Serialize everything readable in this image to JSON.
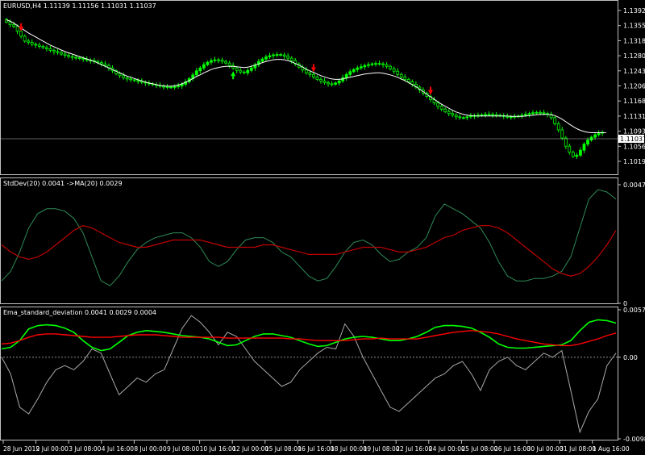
{
  "colors": {
    "background": "#000000",
    "frame": "#c0c0c0",
    "bull": "#00ff00",
    "bear": "#000000",
    "wick": "#00ff00",
    "ma": "#ffffff",
    "stddev": "#2e8b57",
    "stddev_ma": "#c00000",
    "ema_green": "#00ff00",
    "ema_red": "#ff0000",
    "ema_gray": "#a9a9a9",
    "arrow_sell": "#ff0000",
    "arrow_buy": "#00ff00"
  },
  "panels": {
    "main": {
      "title": "EURUSD,H4  1.11139 1.11156 1.11031 1.11037",
      "price_ticks": [
        "1.13920",
        "1.13550",
        "1.13180",
        "1.12800",
        "1.12430",
        "1.12060",
        "1.11680",
        "1.11310",
        "1.10930",
        "1.10560",
        "1.10190"
      ],
      "current_price": "1.11037"
    },
    "stddev": {
      "title": "StdDev(20) 0.0041  ->MA(20) 0.0029",
      "ticks": [
        "0.0047",
        "0"
      ]
    },
    "ema": {
      "title": "Ema_standard_deviation 0.0041 0.0029 0.0004",
      "ticks": [
        "0.0057",
        "0.00",
        "-0.0098"
      ]
    }
  },
  "time_labels": [
    "28 Jun 2019",
    "2 Jul 00:00",
    "3 Jul 08:00",
    "4 Jul 16:00",
    "8 Jul 00:00",
    "9 Jul 08:00",
    "10 Jul 16:00",
    "12 Jul 00:00",
    "15 Jul 08:00",
    "16 Jul 16:00",
    "18 Jul 00:00",
    "19 Jul 08:00",
    "22 Jul 16:00",
    "24 Jul 00:00",
    "25 Jul 08:00",
    "26 Jul 16:00",
    "30 Jul 00:00",
    "31 Jul 08:00",
    "1 Aug 16:00"
  ],
  "chart_data": [
    {
      "type": "candlestick",
      "title": "EURUSD,H4  1.11139 1.11156 1.11031 1.11037",
      "ylim": [
        1.1005,
        1.1405
      ],
      "close": [
        1.1375,
        1.1368,
        1.1364,
        1.1352,
        1.134,
        1.1328,
        1.1325,
        1.132,
        1.1318,
        1.1315,
        1.1312,
        1.1309,
        1.1305,
        1.1302,
        1.13,
        1.1296,
        1.1293,
        1.129,
        1.1288,
        1.1287,
        1.1285,
        1.1283,
        1.1281,
        1.128,
        1.1278,
        1.1275,
        1.1272,
        1.1268,
        1.1262,
        1.1255,
        1.1248,
        1.1243,
        1.1238,
        1.1235,
        1.1233,
        1.1231,
        1.1229,
        1.1227,
        1.1225,
        1.1223,
        1.1221,
        1.1219,
        1.1217,
        1.1216,
        1.1215,
        1.1215,
        1.1216,
        1.1218,
        1.1222,
        1.1228,
        1.1236,
        1.1245,
        1.1255,
        1.1262,
        1.127,
        1.1276,
        1.128,
        1.1282,
        1.1281,
        1.1278,
        1.1274,
        1.1268,
        1.1262,
        1.1256,
        1.1252,
        1.125,
        1.1256,
        1.1262,
        1.127,
        1.1278,
        1.1284,
        1.1289,
        1.1292,
        1.1294,
        1.1295,
        1.1294,
        1.1291,
        1.1286,
        1.128,
        1.1272,
        1.1264,
        1.1257,
        1.125,
        1.1246,
        1.124,
        1.1234,
        1.123,
        1.1226,
        1.1223,
        1.1222,
        1.1225,
        1.123,
        1.1238,
        1.1246,
        1.1253,
        1.1258,
        1.1262,
        1.1265,
        1.1268,
        1.127,
        1.1272,
        1.1273,
        1.1272,
        1.127,
        1.1266,
        1.126,
        1.1254,
        1.1246,
        1.124,
        1.1234,
        1.1228,
        1.1222,
        1.1215,
        1.1208,
        1.12,
        1.1192,
        1.1184,
        1.1176,
        1.1168,
        1.1161,
        1.1155,
        1.115,
        1.1146,
        1.1142,
        1.114,
        1.114,
        1.1142,
        1.1144,
        1.1145,
        1.1146,
        1.1147,
        1.1148,
        1.1148,
        1.1147,
        1.1146,
        1.1145,
        1.1143,
        1.1142,
        1.1142,
        1.1143,
        1.1144,
        1.1146,
        1.1148,
        1.115,
        1.1152,
        1.1153,
        1.1152,
        1.115,
        1.1148,
        1.114,
        1.1125,
        1.111,
        1.109,
        1.107,
        1.1055,
        1.1045,
        1.1048,
        1.106,
        1.1075,
        1.1085,
        1.1092,
        1.1098,
        1.1102,
        1.1104
      ],
      "moving_average": [
        1.138,
        1.1377,
        1.1372,
        1.1366,
        1.136,
        1.1354,
        1.1348,
        1.1343,
        1.1338,
        1.1333,
        1.1328,
        1.1323,
        1.1318,
        1.1314,
        1.131,
        1.1306,
        1.1302,
        1.1299,
        1.1296,
        1.1293,
        1.129,
        1.1287,
        1.1284,
        1.1281,
        1.1278,
        1.1274,
        1.127,
        1.1266,
        1.1262,
        1.1258,
        1.1254,
        1.125,
        1.1246,
        1.1242,
        1.1239,
        1.1236,
        1.1233,
        1.123,
        1.1227,
        1.1225,
        1.1223,
        1.1221,
        1.1219,
        1.1218,
        1.1217,
        1.1217,
        1.1218,
        1.122,
        1.1223,
        1.1227,
        1.1231,
        1.1236,
        1.1241,
        1.1245,
        1.125,
        1.1254,
        1.1258,
        1.1261,
        1.1263,
        1.1265,
        1.1266,
        1.1266,
        1.1266,
        1.1265,
        1.1264,
        1.1263,
        1.1264,
        1.1266,
        1.1269,
        1.1272,
        1.1275,
        1.1278,
        1.128,
        1.1282,
        1.1283,
        1.1283,
        1.1282,
        1.128,
        1.1277,
        1.1273,
        1.1269,
        1.1264,
        1.1259,
        1.1255,
        1.1251,
        1.1247,
        1.1243,
        1.124,
        1.1237,
        1.1235,
        1.1234,
        1.1234,
        1.1235,
        1.1237,
        1.1239,
        1.1241,
        1.1243,
        1.1245,
        1.1247,
        1.1248,
        1.1249,
        1.125,
        1.125,
        1.1249,
        1.1247,
        1.1245,
        1.1242,
        1.1239,
        1.1235,
        1.1231,
        1.1226,
        1.1221,
        1.1216,
        1.121,
        1.1204,
        1.1197,
        1.1191,
        1.1185,
        1.1179,
        1.1173,
        1.1168,
        1.1163,
        1.1158,
        1.1154,
        1.1151,
        1.1148,
        1.1146,
        1.1145,
        1.1144,
        1.1144,
        1.1144,
        1.1144,
        1.1144,
        1.1144,
        1.1144,
        1.1144,
        1.1144,
        1.1144,
        1.1143,
        1.1143,
        1.1143,
        1.1143,
        1.1144,
        1.1145,
        1.1146,
        1.1147,
        1.1148,
        1.1148,
        1.1148,
        1.1147,
        1.1145,
        1.1141,
        1.1136,
        1.113,
        1.1124,
        1.1118,
        1.1113,
        1.1109,
        1.1106,
        1.1104,
        1.1103,
        1.1103,
        1.1103,
        1.1103,
        1.1103
      ]
    },
    {
      "type": "line",
      "title": "StdDev(20) 0.0041  ->MA(20) 0.0029",
      "ylim": [
        0,
        0.0047
      ],
      "series": [
        {
          "values": [
            0.0008,
            0.0012,
            0.002,
            0.003,
            0.0036,
            0.0038,
            0.0038,
            0.0037,
            0.0034,
            0.0028,
            0.0018,
            0.0008,
            0.0006,
            0.001,
            0.0016,
            0.0021,
            0.0024,
            0.0026,
            0.0027,
            0.0028,
            0.0028,
            0.0026,
            0.0022,
            0.0016,
            0.0014,
            0.0016,
            0.0021,
            0.0025,
            0.0026,
            0.0026,
            0.0024,
            0.002,
            0.0018,
            0.0014,
            0.001,
            0.0008,
            0.0009,
            0.0014,
            0.002,
            0.0024,
            0.0025,
            0.0023,
            0.0019,
            0.0016,
            0.0017,
            0.002,
            0.0022,
            0.0026,
            0.0035,
            0.004,
            0.0038,
            0.0036,
            0.0033,
            0.003,
            0.0024,
            0.0016,
            0.001,
            0.0008,
            0.0008,
            0.0009,
            0.0009,
            0.001,
            0.0012,
            0.0018,
            0.003,
            0.0042,
            0.0046,
            0.0045,
            0.0042
          ]
        },
        {
          "values": [
            0.0023,
            0.002,
            0.0018,
            0.0017,
            0.0018,
            0.002,
            0.0023,
            0.0026,
            0.0029,
            0.0031,
            0.003,
            0.0028,
            0.0026,
            0.0024,
            0.0023,
            0.0022,
            0.0022,
            0.0023,
            0.0024,
            0.0025,
            0.0025,
            0.0025,
            0.0025,
            0.0024,
            0.0023,
            0.0022,
            0.0022,
            0.0022,
            0.0022,
            0.0023,
            0.0023,
            0.0022,
            0.0021,
            0.002,
            0.0019,
            0.0019,
            0.0019,
            0.0019,
            0.002,
            0.0021,
            0.0022,
            0.0022,
            0.0022,
            0.0021,
            0.002,
            0.002,
            0.0021,
            0.0022,
            0.0024,
            0.0026,
            0.0027,
            0.0029,
            0.003,
            0.0031,
            0.0031,
            0.003,
            0.0028,
            0.0025,
            0.0022,
            0.0019,
            0.0016,
            0.0013,
            0.0011,
            0.001,
            0.0011,
            0.0014,
            0.0018,
            0.0023,
            0.0029
          ]
        }
      ]
    },
    {
      "type": "line",
      "title": "Ema_standard_deviation 0.0041 0.0029 0.0004",
      "ylim": [
        -0.0098,
        0.0057
      ],
      "series": [
        {
          "values": [
            0.001,
            0.0012,
            0.002,
            0.0034,
            0.0038,
            0.0039,
            0.0038,
            0.0035,
            0.003,
            0.002,
            0.0012,
            0.0008,
            0.001,
            0.0018,
            0.0026,
            0.003,
            0.0032,
            0.0031,
            0.003,
            0.0028,
            0.0026,
            0.0025,
            0.0024,
            0.0022,
            0.0018,
            0.0014,
            0.0015,
            0.002,
            0.0025,
            0.0028,
            0.0028,
            0.0026,
            0.0024,
            0.002,
            0.0016,
            0.0013,
            0.0014,
            0.0018,
            0.0022,
            0.0024,
            0.0025,
            0.0024,
            0.0022,
            0.002,
            0.002,
            0.0022,
            0.0025,
            0.003,
            0.0036,
            0.0038,
            0.0038,
            0.0037,
            0.0035,
            0.003,
            0.0024,
            0.0016,
            0.0012,
            0.0011,
            0.0011,
            0.0012,
            0.0013,
            0.0014,
            0.0015,
            0.002,
            0.0032,
            0.0042,
            0.0045,
            0.0044,
            0.0041
          ]
        },
        {
          "values": [
            0.0016,
            0.0017,
            0.002,
            0.0024,
            0.0027,
            0.0028,
            0.0028,
            0.0027,
            0.0026,
            0.0025,
            0.0024,
            0.0024,
            0.0024,
            0.0025,
            0.0026,
            0.0027,
            0.0027,
            0.0027,
            0.0026,
            0.0025,
            0.0024,
            0.0024,
            0.0024,
            0.0024,
            0.0024,
            0.0023,
            0.0023,
            0.0023,
            0.0023,
            0.0023,
            0.0023,
            0.0023,
            0.0022,
            0.0022,
            0.0021,
            0.002,
            0.002,
            0.002,
            0.002,
            0.0021,
            0.0022,
            0.0022,
            0.0023,
            0.0022,
            0.0022,
            0.0022,
            0.0022,
            0.0024,
            0.0026,
            0.0028,
            0.003,
            0.0031,
            0.0032,
            0.0031,
            0.003,
            0.0028,
            0.0025,
            0.0022,
            0.002,
            0.0018,
            0.0016,
            0.0015,
            0.0014,
            0.0014,
            0.0016,
            0.0019,
            0.0022,
            0.0026,
            0.0029
          ]
        },
        {
          "values": [
            0.0,
            -0.002,
            -0.006,
            -0.0068,
            -0.005,
            -0.003,
            -0.0015,
            -0.001,
            -0.0015,
            -0.0005,
            0.001,
            0.0005,
            -0.002,
            -0.0045,
            -0.0035,
            -0.0025,
            -0.003,
            -0.002,
            -0.0015,
            0.001,
            0.0035,
            0.005,
            0.0042,
            0.003,
            0.0015,
            0.003,
            0.0025,
            0.001,
            -0.0005,
            -0.0015,
            -0.0025,
            -0.0035,
            -0.003,
            -0.0015,
            -0.0005,
            0.0005,
            0.0012,
            0.001,
            0.004,
            0.0025,
            0.0,
            -0.002,
            -0.004,
            -0.006,
            -0.0065,
            -0.0055,
            -0.0045,
            -0.0035,
            -0.0025,
            -0.002,
            -0.001,
            -0.0005,
            -0.002,
            -0.004,
            -0.0015,
            -0.0005,
            0.0,
            -0.001,
            -0.0015,
            -0.0005,
            0.0005,
            0.0,
            0.0008,
            -0.004,
            -0.009,
            -0.0065,
            -0.005,
            -0.001,
            0.0005
          ]
        }
      ]
    }
  ]
}
